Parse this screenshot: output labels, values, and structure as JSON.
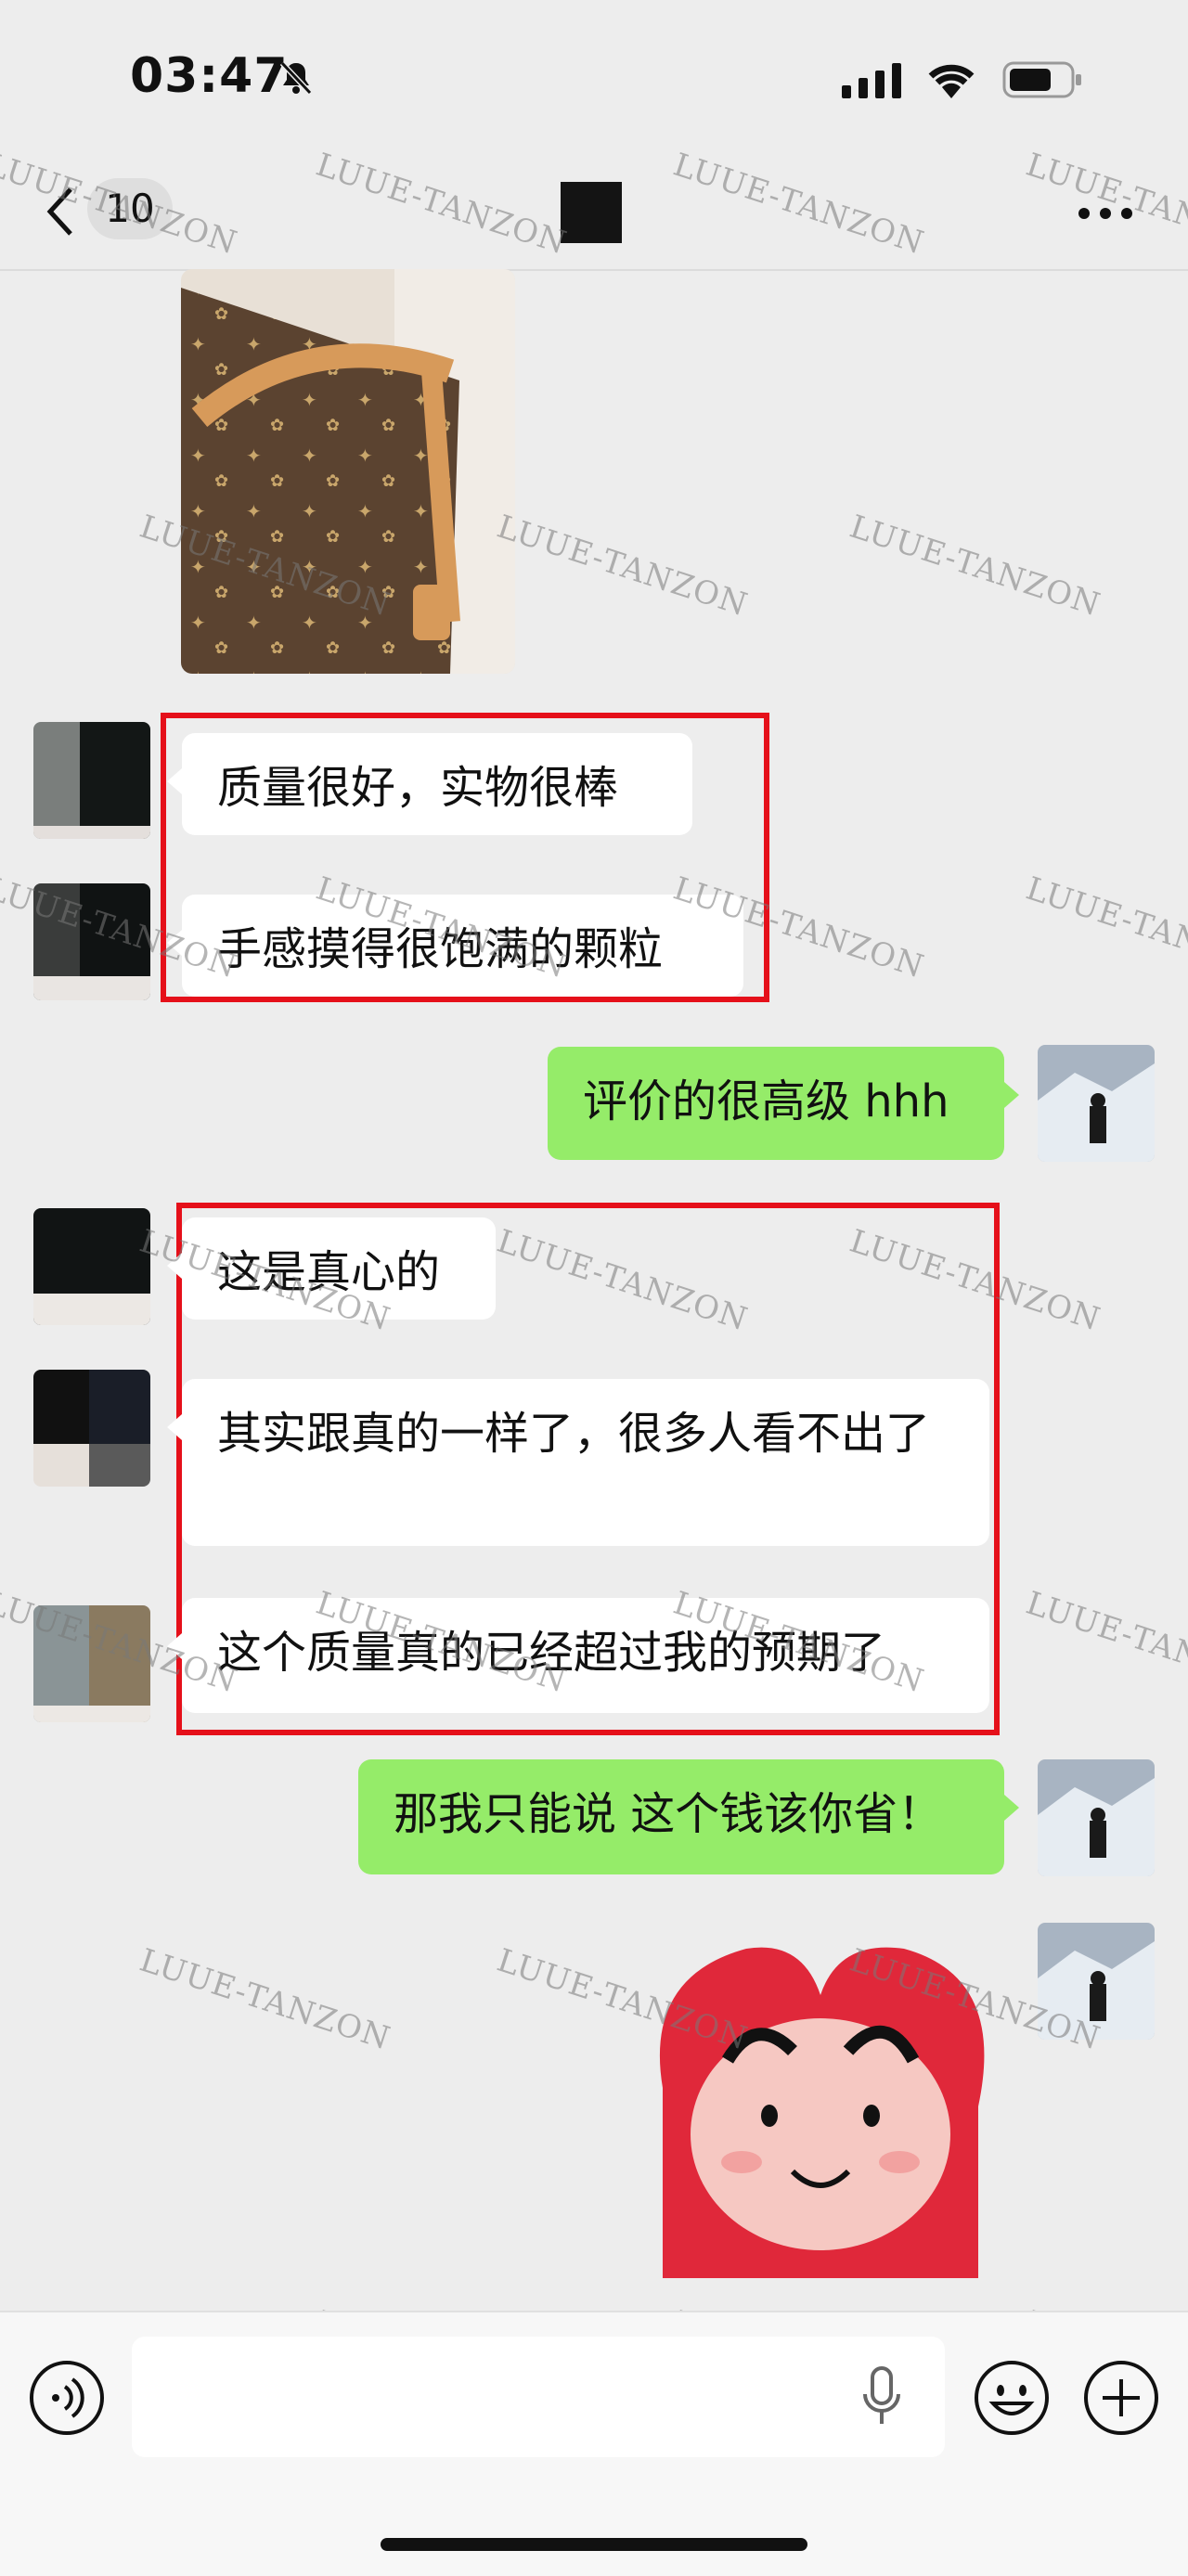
{
  "status_bar": {
    "time": "03:47"
  },
  "nav": {
    "back_count": "10"
  },
  "messages": [
    {
      "side": "left",
      "text": "质量很好，实物很棒"
    },
    {
      "side": "left",
      "text": "手感摸得很饱满的颗粒"
    },
    {
      "side": "right",
      "text": "评价的很高级 hhh"
    },
    {
      "side": "left",
      "text": "这是真心的"
    },
    {
      "side": "left",
      "text": "其实跟真的一样了，很多人看不出了"
    },
    {
      "side": "left",
      "text": "这个质量真的已经超过我的预期了"
    },
    {
      "side": "right",
      "text": "那我只能说 这个钱该你省！"
    }
  ],
  "images": {
    "photo": "handbag-photo",
    "sticker": "cartoon-heart-sticker"
  },
  "watermark": "LUUE-TANZON",
  "colors": {
    "background": "#ededed",
    "bubble_right": "#95ec69",
    "bubble_left": "#ffffff",
    "highlight_box": "#e5101a"
  },
  "input_bar": {
    "icons": [
      "voice-icon",
      "mic-icon",
      "emoji-icon",
      "plus-icon"
    ]
  }
}
